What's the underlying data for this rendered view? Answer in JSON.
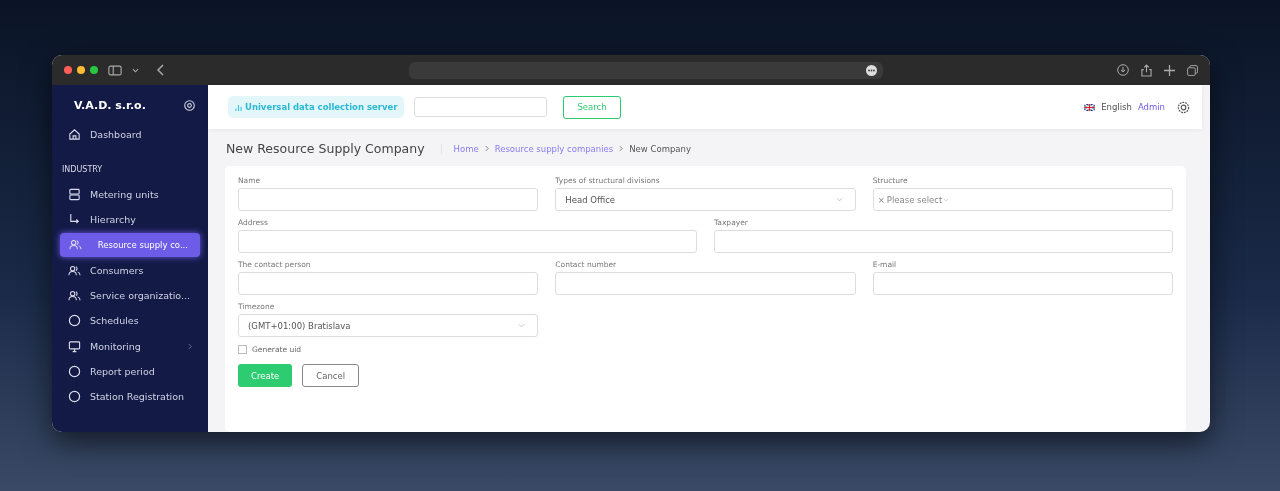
{
  "sidebar": {
    "brand": "V.A.D. s.r.o.",
    "items": [
      {
        "label": "Dashboard",
        "selected": false,
        "kind": "home"
      },
      {
        "label": "INDUSTRY",
        "kind": "section"
      },
      {
        "label": "Metering units",
        "selected": false,
        "kind": "server"
      },
      {
        "label": "Hierarchy",
        "selected": false,
        "kind": "hierarchy"
      },
      {
        "label": "Resource supply co...",
        "selected": true,
        "kind": "users"
      },
      {
        "label": "Consumers",
        "selected": false,
        "kind": "users"
      },
      {
        "label": "Service organizatio...",
        "selected": false,
        "kind": "users"
      },
      {
        "label": "Schedules",
        "selected": false,
        "kind": "circle"
      },
      {
        "label": "Monitoring",
        "selected": false,
        "kind": "monitor",
        "expandable": true
      },
      {
        "label": "Report period",
        "selected": false,
        "kind": "circle"
      },
      {
        "label": "Station Registration",
        "selected": false,
        "kind": "circle"
      }
    ]
  },
  "header": {
    "server_badge": "Universal data collection server",
    "search_button": "Search",
    "language": "English",
    "user": "Admin"
  },
  "page": {
    "title": "New Resource Supply Company",
    "breadcrumbs": [
      {
        "label": "Home",
        "link": true
      },
      {
        "label": "Resource supply companies",
        "link": true
      },
      {
        "label": "New Company",
        "link": false
      }
    ]
  },
  "form": {
    "rows": [
      [
        {
          "label": "Name",
          "kind": "text"
        },
        {
          "label": "Types of structural divisions",
          "kind": "select",
          "value": "Head Office"
        },
        {
          "label": "Structure",
          "kind": "multiselect",
          "clear_mark": "×",
          "placeholder": "Please select"
        }
      ],
      [
        {
          "label": "Address",
          "kind": "text"
        },
        {
          "label": "Taxpayer",
          "kind": "text"
        }
      ],
      [
        {
          "label": "The contact person",
          "kind": "text"
        },
        {
          "label": "Contact number",
          "kind": "text"
        },
        {
          "label": "E-mail",
          "kind": "text"
        }
      ],
      [
        {
          "label": "Timezone",
          "kind": "select",
          "value": "(GMT+01:00) Bratislava"
        }
      ]
    ],
    "checkbox": {
      "label": "Generate uid",
      "checked": false
    },
    "buttons": [
      {
        "label": "Create",
        "kind": "primary"
      },
      {
        "label": "Cancel",
        "kind": "secondary"
      }
    ]
  }
}
